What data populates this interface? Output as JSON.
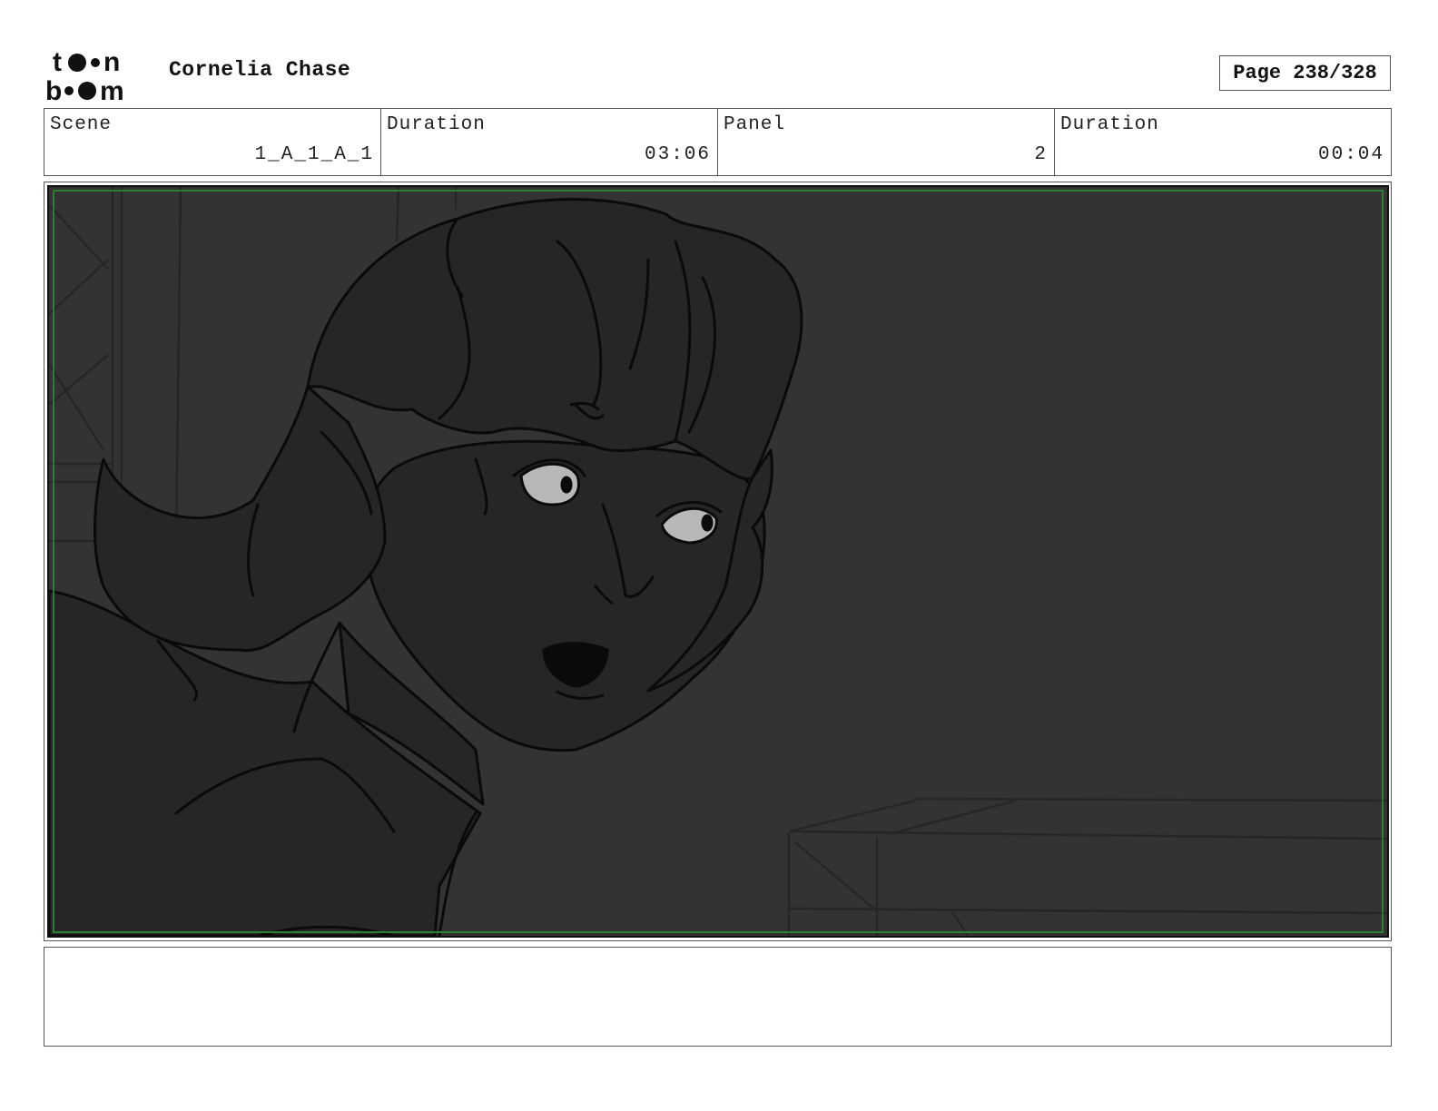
{
  "header": {
    "logo_text": "toon boom",
    "project_title": "Cornelia Chase",
    "page_label": "Page 238/328"
  },
  "info": {
    "scene_label": "Scene",
    "scene_value": "1_A_1_A_1",
    "scene_duration_label": "Duration",
    "scene_duration_value": "03:06",
    "panel_label": "Panel",
    "panel_value": "2",
    "panel_duration_label": "Duration",
    "panel_duration_value": "00:04"
  },
  "panel": {
    "background_color": "#333333",
    "safe_frame_color": "#2e7d32",
    "eye_color": "#b8b8b8"
  },
  "notes": {
    "text": ""
  }
}
